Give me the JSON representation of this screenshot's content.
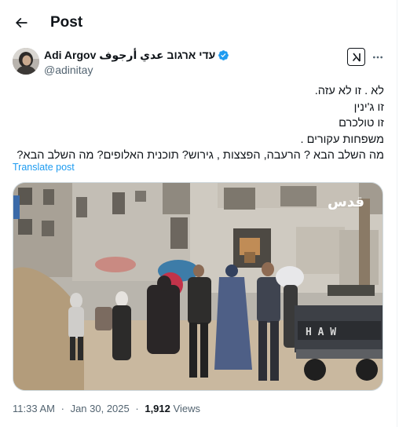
{
  "header": {
    "title": "Post"
  },
  "author": {
    "display_name": "Adi Argov עדי ארגוב عدي أرجوف",
    "handle": "@adinitay",
    "verified_color": "#1d9bf0"
  },
  "tweet": {
    "lines": [
      "לא . זו לא עזה.",
      "זו ג'ינין",
      "זו טולכרם",
      "משפחות עקורים .",
      "מה השלב הבא ? הרעבה, הפצצות , גירוש? תוכנית האלופים? מה השלב הבא?"
    ],
    "translate_label": "Translate post"
  },
  "media": {
    "watermark": "قدس",
    "vehicle_text": "H A W"
  },
  "meta": {
    "time": "11:33 AM",
    "date": "Jan 30, 2025",
    "separator": "·",
    "views_count": "1,912",
    "views_label": "Views"
  },
  "colors": {
    "accent": "#1d9bf0",
    "text": "#0f1419",
    "muted": "#536471",
    "border": "#cfd9de"
  },
  "icons": {
    "back": "arrow-left-icon",
    "verified": "verified-badge-icon",
    "grok": "grok-icon",
    "more": "more-icon"
  }
}
